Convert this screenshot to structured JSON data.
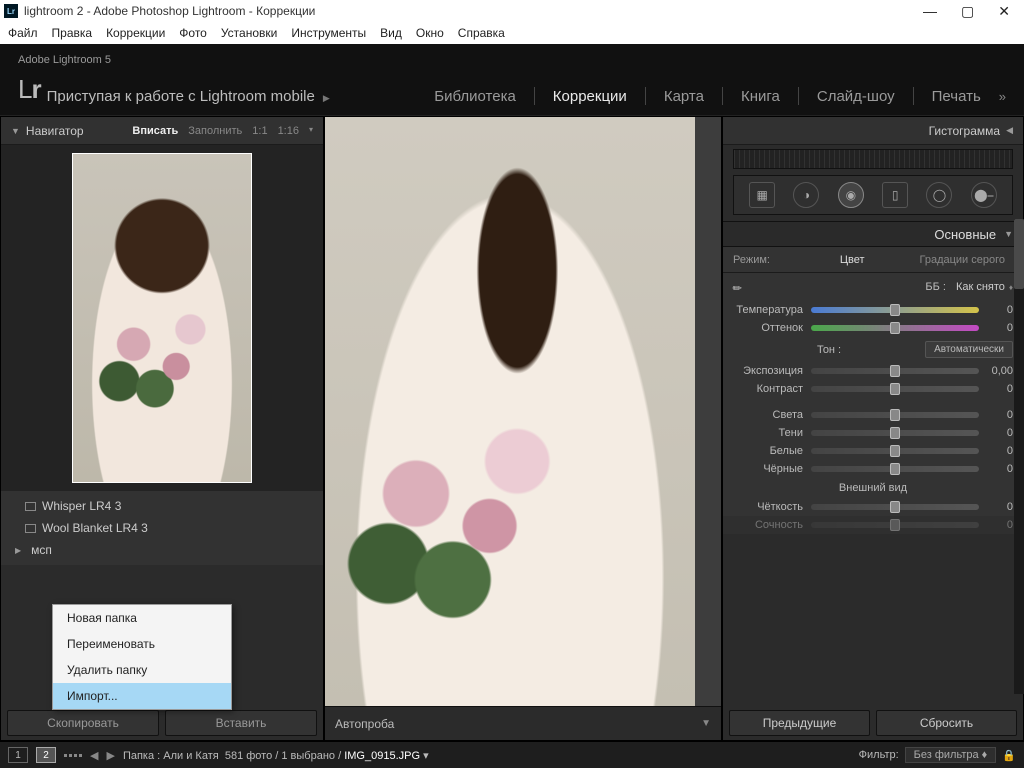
{
  "title": "lightroom 2 - Adobe Photoshop Lightroom - Коррекции",
  "menubar": [
    "Файл",
    "Правка",
    "Коррекции",
    "Фото",
    "Установки",
    "Инструменты",
    "Вид",
    "Окно",
    "Справка"
  ],
  "brand_line": "Adobe Lightroom 5",
  "mobile_cta": "Приступая к работе с Lightroom mobile",
  "modules": {
    "items": [
      "Библиотека",
      "Коррекции",
      "Карта",
      "Книга",
      "Слайд-шоу",
      "Печать"
    ],
    "active": 1,
    "more": "»"
  },
  "navigator": {
    "title": "Навигатор",
    "zoom": [
      "Вписать",
      "Заполнить",
      "1:1",
      "1:16"
    ],
    "zoom_sel": 0
  },
  "presets": {
    "items": [
      "Whisper LR4 3",
      "Wool Blanket LR4 3"
    ],
    "folder": "мсп"
  },
  "left_buttons": {
    "copy": "Скопировать",
    "paste": "Вставить"
  },
  "context_menu": {
    "items": [
      "Новая папка",
      "Переименовать",
      "Удалить папку",
      "Импорт..."
    ],
    "selected": 3
  },
  "center": {
    "bottom_label": "Автопроба"
  },
  "right": {
    "histogram": "Гистограмма",
    "basics": "Основные",
    "mode_label": "Режим:",
    "mode_color": "Цвет",
    "mode_gray": "Градации серого",
    "wb_label": "ББ :",
    "wb_value": "Как снято",
    "sliders_wb": [
      {
        "l": "Температура",
        "v": "0"
      },
      {
        "l": "Оттенок",
        "v": "0"
      }
    ],
    "tone_label": "Тон :",
    "tone_auto": "Автоматически",
    "sliders_tone": [
      {
        "l": "Экспозиция",
        "v": "0,00"
      },
      {
        "l": "Контраст",
        "v": "0"
      }
    ],
    "sliders_tone2": [
      {
        "l": "Света",
        "v": "0"
      },
      {
        "l": "Тени",
        "v": "0"
      },
      {
        "l": "Белые",
        "v": "0"
      },
      {
        "l": "Чёрные",
        "v": "0"
      }
    ],
    "presence": "Внешний вид",
    "sliders_presence": [
      {
        "l": "Чёткость",
        "v": "0"
      },
      {
        "l": "Сочность",
        "v": "0"
      }
    ],
    "prev": "Предыдущие",
    "reset": "Сбросить"
  },
  "status": {
    "pages": [
      "1",
      "2"
    ],
    "crumb_label": "Папка :",
    "crumb_folder": "Али и Катя",
    "count": "581 фото",
    "selected": "1 выбрано",
    "filename": "IMG_0915.JPG",
    "filter_label": "Фильтр:",
    "filter_value": "Без фильтра"
  }
}
